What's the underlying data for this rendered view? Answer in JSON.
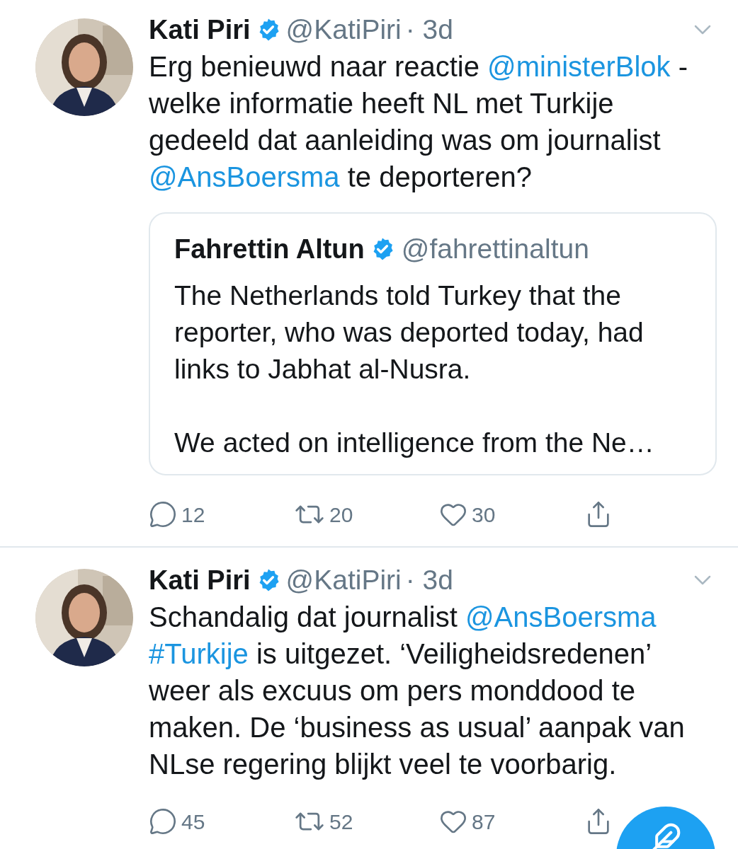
{
  "tweets": [
    {
      "name": "Kati Piri",
      "handle": "@KatiPiri",
      "time": "· 3d",
      "body": [
        {
          "kind": "text",
          "text": "Erg benieuwd naar reactie "
        },
        {
          "kind": "link",
          "text": "@ministerBlok"
        },
        {
          "kind": "text",
          "text": " - welke informatie heeft NL met Turkije gedeeld dat aanleiding was om journalist "
        },
        {
          "kind": "link",
          "text": "@AnsBoersma"
        },
        {
          "kind": "text",
          "text": " te deporteren?"
        }
      ],
      "quote": {
        "name": "Fahrettin Altun",
        "handle": "@fahrettinaltun",
        "paragraphs": [
          "The Netherlands told Turkey that the reporter, who was deported today, had links to Jabhat al-Nusra.",
          "We acted on intelligence from the Ne…"
        ]
      },
      "actions": {
        "replies": "12",
        "retweets": "20",
        "likes": "30"
      }
    },
    {
      "name": "Kati Piri",
      "handle": "@KatiPiri",
      "time": "· 3d",
      "body": [
        {
          "kind": "text",
          "text": "Schandalig dat journalist "
        },
        {
          "kind": "link",
          "text": "@AnsBoersma"
        },
        {
          "kind": "link",
          "text": "#Turkije"
        },
        {
          "kind": "text",
          "text": " is uitgezet. ‘Veiligheidsredenen’ weer als excuus om pers monddood te maken. De ‘business as usual’ aanpak van NLse regering blijkt veel te voorbarig."
        }
      ],
      "actions": {
        "replies": "45",
        "retweets": "52",
        "likes": "87"
      }
    }
  ]
}
